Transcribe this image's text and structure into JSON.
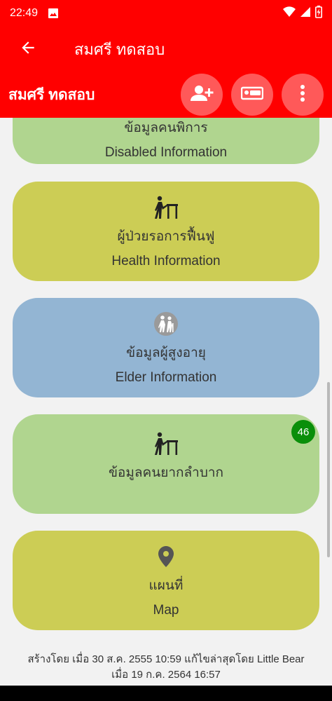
{
  "status_bar": {
    "time": "22:49",
    "icons": [
      "image-icon",
      "wifi-icon",
      "signal-icon",
      "battery-charging-icon"
    ]
  },
  "app_bar": {
    "title": "สมศรี ทดสอบ",
    "back_icon": "arrow-left-icon"
  },
  "sub_header": {
    "name": "สมศรี ทดสอบ",
    "actions": [
      "add-person-icon",
      "bed-icon",
      "more-vert-icon"
    ]
  },
  "cards": [
    {
      "title_th": "ข้อมูลคนพิการ",
      "title_en": "Disabled Information",
      "color": "#b0d58f"
    },
    {
      "title_th": "ผู้ป่วยรอการฟื้นฟู",
      "title_en": "Health Information",
      "icon": "elderly-walker-icon",
      "color": "#cccd55"
    },
    {
      "title_th": "ข้อมูลผู้สูงอายุ",
      "title_en": "Elder Information",
      "icon": "elderly-couple-icon",
      "color": "#93b5d3"
    },
    {
      "title_th": "ข้อมูลคนยากลำบาก",
      "icon": "elderly-walker-icon",
      "badge": "46",
      "color": "#b0d58f"
    },
    {
      "title_th": "แผนที่",
      "title_en": "Map",
      "icon": "map-pin-icon",
      "color": "#cccd55"
    }
  ],
  "footer": {
    "line1": "สร้างโดย เมื่อ 30 ส.ค. 2555 10:59 แก้ไขล่าสุดโดย Little Bear",
    "line2": "เมื่อ 19 ก.ค. 2564 16:57"
  }
}
